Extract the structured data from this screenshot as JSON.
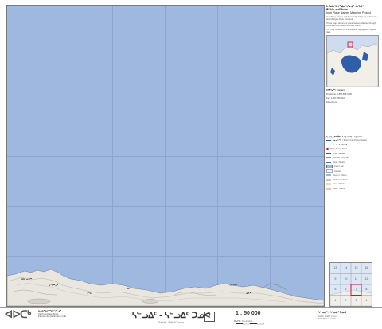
{
  "map": {
    "top_ticks": [
      "",
      "",
      "",
      "",
      "",
      ""
    ]
  },
  "sidebar": {
    "title": "ᐅᖃᐅᓯᐅᔪᑦ ᐃᓕᓴᕐᓂᒧᑦ ᐊᓯᐅᔨᑦ ᑭᓐᖑᕆᓂᐊᕐᕕᐊᓂ",
    "subtitle": "Inuit Place Names Mapping Project",
    "para1": "Inuit Place Names and Knowledge Mapping of the Area around Clyde River, Nunavut",
    "para2": "These maps document place names collected through interviews with elders and land users.",
    "para3": "The map is based on the National Topographic System data.",
    "contact_title": "ᑎᑎᕋᕐᓂᖅ / Contact",
    "contact_phone": "Telephone: 1-867-555-0100",
    "contact_fax": "Fax: 1-867-555-0101",
    "contact_web": "www.ihti.ca",
    "legend_title": "ᓇᓗᓇᐃᔭᐅᑏᑦ | Legend | Légende",
    "legend_items": [
      "ᐃᓂᓕᐅᕐᑕ / Toponyms / Place Names",
      "ᐃᓄᖕᓂᒃ ᐊᑎᖏᑦ",
      "Place Name Point",
      "Trail / Sentier",
      "Contour / Courbe",
      "River / Rivière",
      "Lake / Lac",
      "Glacier",
      "Ocean / Océan",
      "Wetland / Marais",
      "Sand / Sable",
      "Rock / Roche"
    ]
  },
  "index_map": {
    "cells": [
      "13",
      "14",
      "15",
      "16",
      "9",
      "10",
      "11",
      "12",
      "5",
      "6",
      "7",
      "8",
      "1",
      "2",
      "3",
      "4"
    ],
    "label": "ᓴᓪᓗᐃᑦ · ᓴᓪᓗᐃᑦ ᑐᓄᐊ"
  },
  "places": [
    "ᐃᑲᓪᓗᐊᖅ",
    "ᑲᖏᖅᖢᒃ",
    "ᐊᕐᕕᑦ",
    "ᐃᒪᖅ",
    "ᓯᓪᓕᖅ",
    "ᓄᕗᖅ"
  ],
  "footer": {
    "logo": "ᐊᐅᑕᒃ",
    "logo_text_1": "ᐃᓄᐃᑦ ᐃᓕᖅᑯᓯᖏᓐᓄᑦ",
    "logo_text_2": "Inuit Heritage Trust",
    "logo_text_3": "Fiducie du patrimoine inuit",
    "sheet_title": "ᓴᓪᓗᐃᑦ - ᓴᓪᓗᐃᑦ ᑐᓄᐊ",
    "sheet_sub": "Salluit - Salluit Tunua",
    "sheet_num": "7",
    "scale": "1 : 50 000",
    "scale_sub": "ᑭᓛᒥᑕ / Kilomètres",
    "right_title": "ᓴᓪᓗᐃᑦ - ᓴᓪᓗᐃᑦ ᑐᓄᐊ",
    "right_sub1": "Salluit - Salluit Tunua",
    "right_sub2": "NTS 35J/14 · ©2019"
  }
}
